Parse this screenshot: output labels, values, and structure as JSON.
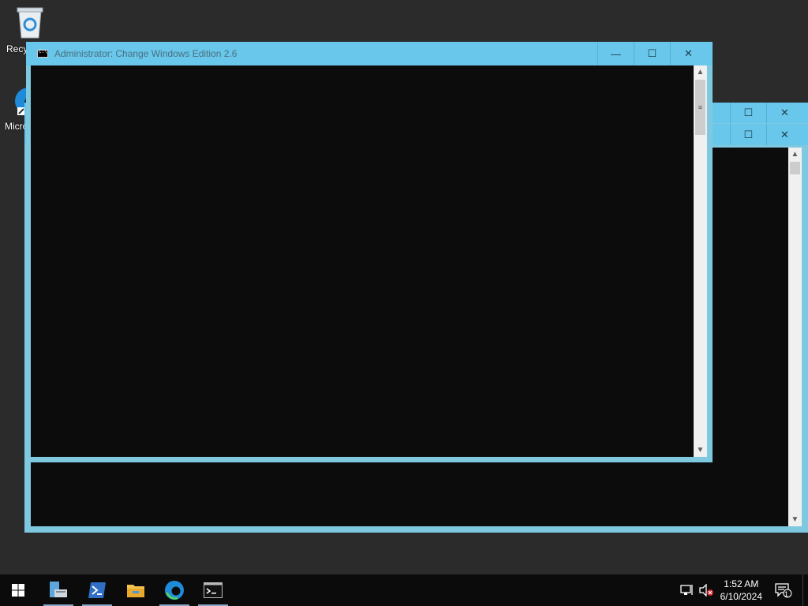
{
  "desktop": {
    "icons": [
      {
        "label": "Recycle Bin",
        "icon": "recycle-bin-icon"
      },
      {
        "label": "Microsoft Edge",
        "icon": "edge-icon"
      }
    ]
  },
  "front_window": {
    "title": "Administrator:  Change Windows Edition 2.6",
    "icon": "cmd-icon",
    "controls": {
      "minimize": "—",
      "maximize": "☐",
      "close": "✕"
    }
  },
  "back_window": {
    "controls": {
      "maximize": "☐",
      "close": "✕"
    }
  },
  "taskbar": {
    "items": [
      {
        "icon": "start-icon"
      },
      {
        "icon": "server-manager-icon"
      },
      {
        "icon": "powershell-icon"
      },
      {
        "icon": "file-explorer-icon"
      },
      {
        "icon": "edge-icon"
      },
      {
        "icon": "command-prompt-icon"
      }
    ],
    "clock_time": "1:52 AM",
    "clock_date": "6/10/2024",
    "notification_count": "1"
  },
  "colors": {
    "titlebar": "#68c7ea",
    "console_bg": "#0c0c0c",
    "desktop_bg": "#2b2b2b",
    "taskbar_bg": "#0b0b0b"
  }
}
